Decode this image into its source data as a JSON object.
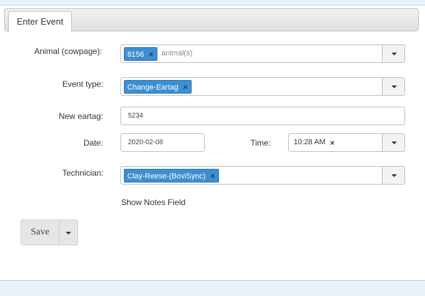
{
  "tab": {
    "label": "Enter Event"
  },
  "form": {
    "animal": {
      "label": "Animal (cowpage):",
      "selected": "8156",
      "remove_glyph": "×",
      "placeholder": "animal(s)"
    },
    "event_type": {
      "label": "Event type:",
      "selected": "Change-Eartag",
      "remove_glyph": "×"
    },
    "new_eartag": {
      "label": "New eartag:",
      "value": "5234"
    },
    "date": {
      "label": "Date:",
      "value": "2020-02-08"
    },
    "time": {
      "label": "Time:",
      "value": "10:28 AM",
      "clear_glyph": "×"
    },
    "technician": {
      "label": "Technician:",
      "selected": "Clay-Reese-(BoviSync)",
      "remove_glyph": "×"
    },
    "notes_link": "Show Notes Field"
  },
  "actions": {
    "save_label": "Save"
  },
  "colors": {
    "chip_bg": "#3e8ed0",
    "tab_bar": "#dedede",
    "page_strip": "#e8f2fb"
  },
  "icons": {
    "dropdown": "chevron-down-icon",
    "remove": "close-icon"
  }
}
